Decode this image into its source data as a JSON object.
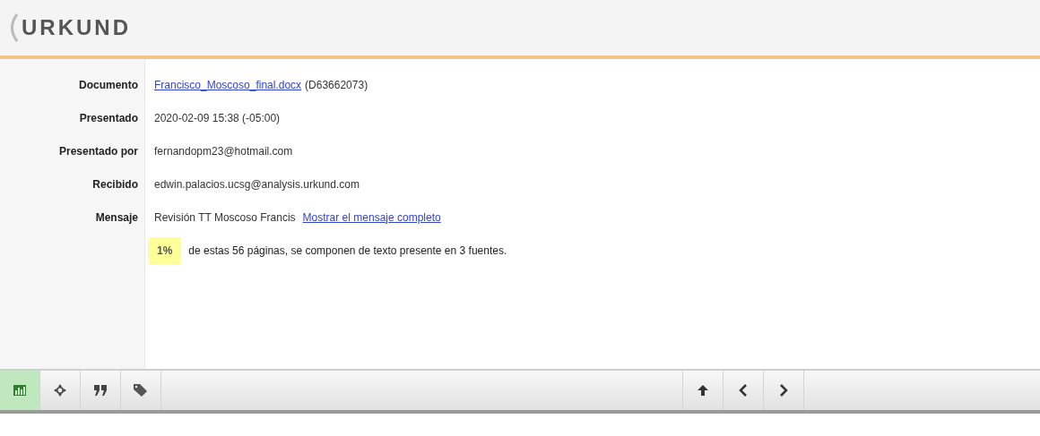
{
  "header": {
    "logo": "URKUND"
  },
  "details": [
    {
      "label": "Documento",
      "value": "Francisco_Moscoso_final.docx",
      "kind": "link",
      "suffix": "(D63662073)"
    },
    {
      "label": "Presentado",
      "value": "2020-02-09 15:38 (-05:00)",
      "kind": "text"
    },
    {
      "label": "Presentado por",
      "value": "fernandopm23@hotmail.com",
      "kind": "text"
    },
    {
      "label": "Recibido",
      "value": "edwin.palacios.ucsg@analysis.urkund.com",
      "kind": "text"
    },
    {
      "label": "Mensaje",
      "value": "Revisión TT Moscoso Francis",
      "kind": "text",
      "link": "Mostrar el mensaje completo"
    }
  ],
  "summary": {
    "percent": "1%",
    "text": "de estas 56 páginas, se componen de texto presente en 3 fuentes."
  },
  "toolbar_left": [
    {
      "kind": "chart",
      "selected": true
    },
    {
      "kind": "target",
      "selected": false
    },
    {
      "kind": "quote",
      "selected": false
    },
    {
      "kind": "tag",
      "selected": false
    }
  ],
  "toolbar_right": [
    {
      "kind": "up"
    },
    {
      "kind": "prev"
    },
    {
      "kind": "next"
    }
  ]
}
